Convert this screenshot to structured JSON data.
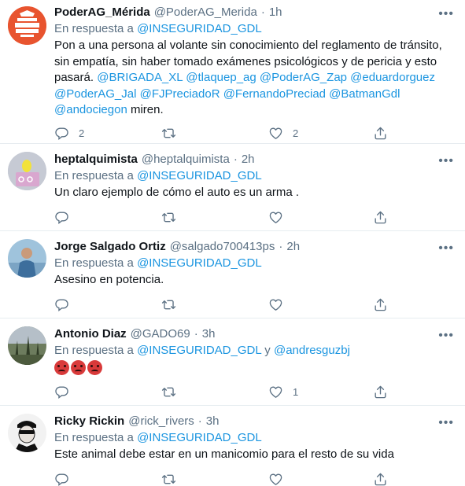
{
  "reply_prefix": "En respuesta a",
  "tweets": [
    {
      "name": "PoderAG_Mérida",
      "handle": "@PoderAG_Merida",
      "time": "1h",
      "reply_to": "@INSEGURIDAD_GDL",
      "reply_and": "",
      "reply_to_2": "",
      "text_intro": "Pon a una persona al volante sin conocimiento del reglamento de tránsito, sin empatía, sin haber tomado exámenes psicológicos y de pericia y esto pasará.",
      "mentions": "@BRIGADA_XL @tlaquep_ag @PoderAG_Zap @eduardorguez @PoderAG_Jal @FJPreciadoR @FernandoPreciad @BatmanGdl @andociegon",
      "text_outro": "miren.",
      "replies": "2",
      "retweets": "",
      "likes": "2",
      "avatar_text": "PODER ANTI GANDALLA"
    },
    {
      "name": "heptalquimista",
      "handle": "@heptalquimista",
      "time": "2h",
      "reply_to": "@INSEGURIDAD_GDL",
      "text": "Un claro ejemplo de cómo el auto es un arma .",
      "replies": "",
      "retweets": "",
      "likes": ""
    },
    {
      "name": "Jorge Salgado Ortiz",
      "handle": "@salgado700413ps",
      "time": "2h",
      "reply_to": "@INSEGURIDAD_GDL",
      "text": "Asesino en potencia.",
      "replies": "",
      "retweets": "",
      "likes": ""
    },
    {
      "name": "Antonio Diaz",
      "handle": "@GADO69",
      "time": "3h",
      "reply_to": "@INSEGURIDAD_GDL",
      "reply_and": "y",
      "reply_to_2": "@andresguzbj",
      "replies": "",
      "retweets": "",
      "likes": "1"
    },
    {
      "name": "Ricky Rickin",
      "handle": "@rick_rivers",
      "time": "3h",
      "reply_to": "@INSEGURIDAD_GDL",
      "text": "Este animal debe estar en un manicomio para el resto de su vida",
      "replies": "",
      "retweets": "",
      "likes": ""
    }
  ],
  "colors": {
    "link": "#1b95e0",
    "muted": "#5b7083",
    "text": "#0f1419",
    "divider": "#e6ecf0"
  }
}
